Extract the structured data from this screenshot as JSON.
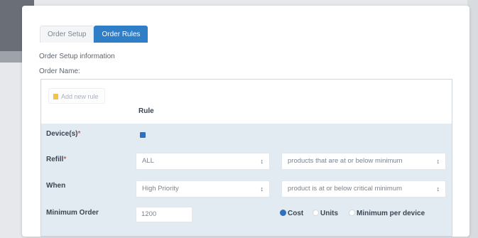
{
  "tabs": {
    "order_setup": "Order Setup",
    "order_rules": "Order Rules"
  },
  "section": {
    "info_title": "Order Setup information",
    "order_name_label": "Order Name:"
  },
  "rules": {
    "add_button": "Add new rule",
    "column_header": "Rule",
    "devices": {
      "label": "Device(s)",
      "required_mark": "*",
      "checked": true
    },
    "refill": {
      "label": "Refill",
      "required_mark": "*",
      "select_value": "ALL",
      "condition_value": "products that are at or below minimum"
    },
    "when": {
      "label": "When",
      "select_value": "High Priority",
      "condition_value": "product is at or below critical minimum"
    },
    "minimum_order": {
      "label": "Minimum Order",
      "value": "1200",
      "options": [
        "Cost",
        "Units",
        "Minimum per device"
      ],
      "selected": "Cost"
    }
  },
  "colors": {
    "accent": "#2f7ec8",
    "grid_bg": "#e3ebf2",
    "required": "#d9534f"
  }
}
